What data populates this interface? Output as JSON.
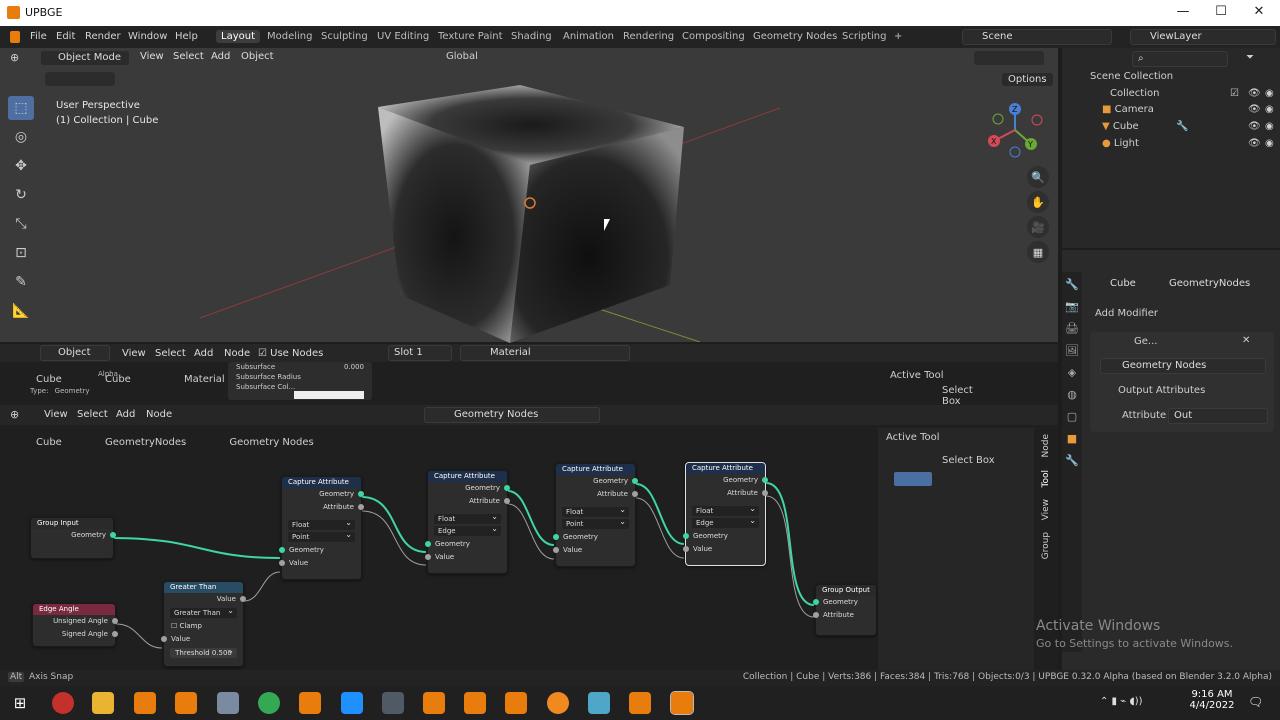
{
  "window": {
    "title": "UPBGE",
    "controls": [
      "—",
      "☐",
      "✕"
    ]
  },
  "menus": [
    "File",
    "Edit",
    "Render",
    "Window",
    "Help"
  ],
  "workspaces": [
    "Layout",
    "Modeling",
    "Sculpting",
    "UV Editing",
    "Texture Paint",
    "Shading",
    "Animation",
    "Rendering",
    "Compositing",
    "Geometry Nodes",
    "Scripting",
    "+"
  ],
  "scene": "Scene",
  "view_layer": "ViewLayer",
  "viewport": {
    "mode": "Object Mode",
    "menus": [
      "View",
      "Select",
      "Add",
      "Object"
    ],
    "orientation": "Global",
    "options": "Options",
    "overlay_line1": "User Perspective",
    "overlay_line2": "(1) Collection | Cube"
  },
  "gizmo": {
    "x": "X",
    "y": "Y",
    "z": "Z"
  },
  "outliner": {
    "root": "Scene Collection",
    "collection": "Collection",
    "items": [
      "Camera",
      "Cube",
      "Light"
    ]
  },
  "properties": {
    "breadcrumb_object": "Cube",
    "breadcrumb_mod": "GeometryNodes",
    "add_modifier": "Add Modifier",
    "modifier_name": "Ge...",
    "node_group": "Geometry Nodes",
    "output_attributes": "Output Attributes",
    "attribute_label": "Attribute",
    "attribute_value": "Out"
  },
  "shader_editor": {
    "object_type": "Object",
    "menus": [
      "View",
      "Select",
      "Add",
      "Node"
    ],
    "use_nodes": "Use Nodes",
    "slot": "Slot 1",
    "material": "Material",
    "breadcrumb": [
      "Cube",
      "Cube",
      "Material"
    ],
    "alpha": "Alpha",
    "type_label": "Type:",
    "type_value": "Geometry",
    "props": [
      "Subsurface",
      "Subsurface Radius",
      "Subsurface Col..."
    ],
    "subsurface_val": "0.000",
    "active_tool": "Active Tool",
    "select_box": "Select Box"
  },
  "geo_editor": {
    "menus": [
      "View",
      "Select",
      "Add",
      "Node"
    ],
    "tree": "Geometry Nodes",
    "breadcrumb": [
      "Cube",
      "GeometryNodes",
      "Geometry Nodes"
    ],
    "active_tool": "Active Tool",
    "select_box": "Select Box",
    "tabs": [
      "Node",
      "Tool",
      "View",
      "Group"
    ]
  },
  "nodes": {
    "group_input": {
      "title": "Group Input",
      "out": "Geometry"
    },
    "edge_angle": {
      "title": "Edge Angle",
      "out1": "Unsigned Angle",
      "out2": "Signed Angle"
    },
    "greater_than": {
      "title": "Greater Than",
      "out": "Value",
      "op": "Greater Than",
      "clamp": "Clamp",
      "in": "Value",
      "threshold_label": "Threshold",
      "threshold": "0.500"
    },
    "capture": [
      {
        "title": "Capture Attribute",
        "type": "Float",
        "domain": "Point"
      },
      {
        "title": "Capture Attribute",
        "type": "Float",
        "domain": "Edge"
      },
      {
        "title": "Capture Attribute",
        "type": "Float",
        "domain": "Point"
      },
      {
        "title": "Capture Attribute",
        "type": "Float",
        "domain": "Edge"
      }
    ],
    "capture_labels": {
      "geometry": "Geometry",
      "attribute": "Attribute",
      "value": "Value"
    },
    "group_output": {
      "title": "Group Output",
      "in1": "Geometry",
      "in2": "Attribute"
    }
  },
  "status": {
    "left": "Axis Snap",
    "right": "Collection | Cube | Verts:386 | Faces:384 | Tris:768 | Objects:0/3 | UPBGE 0.32.0 Alpha (based on Blender 3.2.0 Alpha)"
  },
  "watermark": {
    "line1": "Activate Windows",
    "line2": "Go to Settings to activate Windows."
  },
  "taskbar": {
    "time": "9:16 AM",
    "date": "4/4/2022"
  }
}
